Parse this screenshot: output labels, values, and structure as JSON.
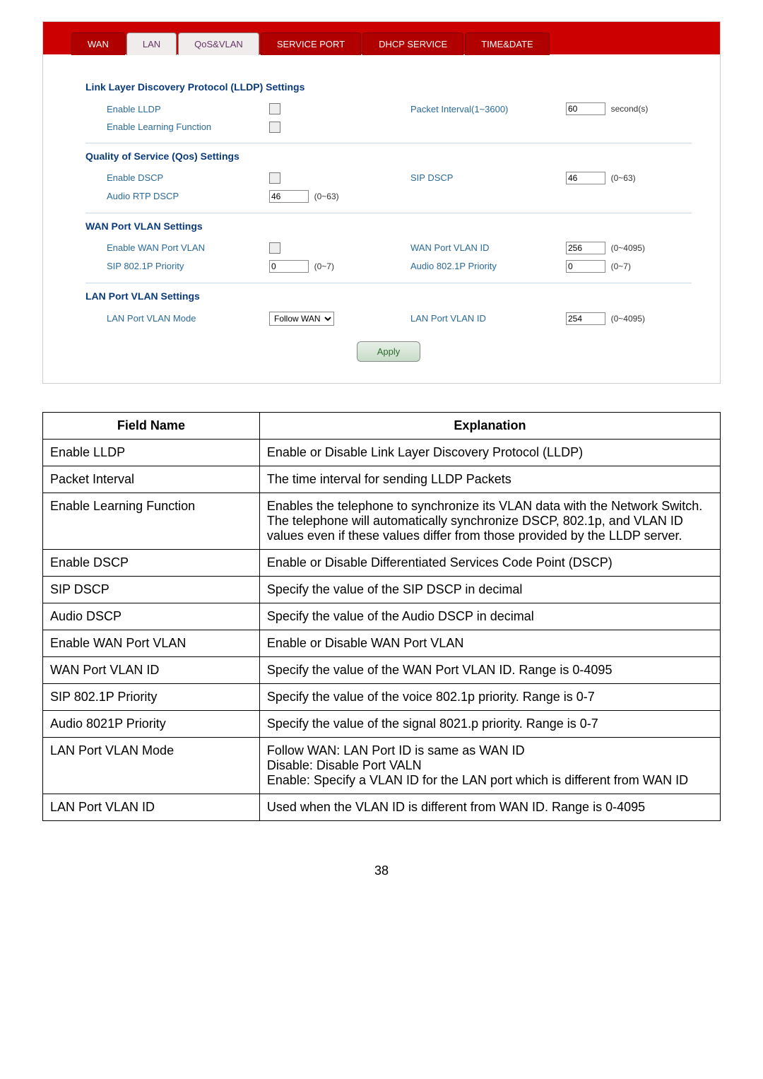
{
  "tabs": {
    "wan": "WAN",
    "lan": "LAN",
    "qos": "QoS&VLAN",
    "svc": "SERVICE PORT",
    "dhcp": "DHCP SERVICE",
    "td": "TIME&DATE"
  },
  "sect": {
    "lldp_head": "Link Layer Discovery Protocol (LLDP) Settings",
    "enable_lldp": "Enable LLDP",
    "pkt_int": "Packet Interval(1~3600)",
    "pkt_val": "60",
    "pkt_unit": "second(s)",
    "elf": "Enable Learning Function",
    "qos_head": "Quality of Service (Qos) Settings",
    "e_dscp": "Enable DSCP",
    "sip_dscp": "SIP DSCP",
    "sip_dscp_val": "46",
    "sip_dscp_hint": "(0~63)",
    "a_rtp": "Audio RTP DSCP",
    "a_rtp_val": "46",
    "a_rtp_hint": "(0~63)",
    "wan_head": "WAN Port VLAN Settings",
    "e_wan": "Enable WAN Port VLAN",
    "wan_id": "WAN Port VLAN ID",
    "wan_id_val": "256",
    "wan_id_hint": "(0~4095)",
    "sip_pri": "SIP 802.1P Priority",
    "sip_pri_val": "0",
    "sip_pri_hint": "(0~7)",
    "aud_pri": "Audio 802.1P Priority",
    "aud_pri_val": "0",
    "aud_pri_hint": "(0~7)",
    "lan_head": "LAN Port VLAN Settings",
    "lan_mode": "LAN Port VLAN Mode",
    "lan_mode_val": "Follow WAN",
    "lan_id": "LAN Port VLAN ID",
    "lan_id_val": "254",
    "lan_id_hint": "(0~4095)",
    "apply": "Apply"
  },
  "table": {
    "h1": "Field Name",
    "h2": "Explanation",
    "rows": [
      {
        "f": "Enable LLDP",
        "e": "Enable or Disable Link Layer Discovery Protocol (LLDP)"
      },
      {
        "f": "Packet Interval",
        "e": "The time interval for sending LLDP Packets"
      },
      {
        "f": "Enable Learning Function",
        "e": "Enables the telephone to synchronize its VLAN data with the Network Switch. The telephone will automatically synchronize DSCP, 802.1p, and VLAN ID values even if these values differ from those provided by the LLDP server."
      },
      {
        "f": "Enable DSCP",
        "e": "Enable or Disable Differentiated Services Code Point (DSCP)"
      },
      {
        "f": "SIP DSCP",
        "e": "Specify the value of the SIP DSCP in decimal"
      },
      {
        "f": "Audio DSCP",
        "e": "Specify the value of the Audio DSCP in decimal"
      },
      {
        "f": "Enable WAN Port VLAN",
        "e": "Enable or Disable WAN Port VLAN"
      },
      {
        "f": "WAN Port VLAN ID",
        "e": "Specify the value of the WAN Port VLAN ID.    Range is 0-4095"
      },
      {
        "f": "SIP 802.1P Priority",
        "e": "Specify the value of the voice 802.1p priority.    Range is 0-7"
      },
      {
        "f": "Audio 8021P Priority",
        "e": "Specify the value of the signal 8021.p priority.    Range is 0-7"
      },
      {
        "f": "LAN Port VLAN Mode",
        "e": "Follow WAN: LAN Port ID is same as WAN ID\nDisable: Disable Port VALN\nEnable: Specify a VLAN ID for the LAN port which is different from WAN ID"
      },
      {
        "f": "LAN Port VLAN ID",
        "e": "Used when the VLAN ID is different from WAN ID.    Range is 0-4095"
      }
    ]
  },
  "pageno": "38"
}
